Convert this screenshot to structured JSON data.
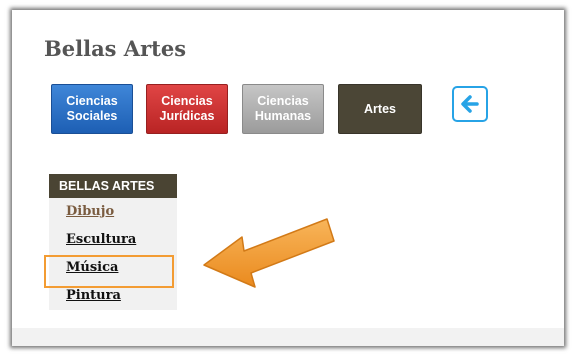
{
  "page": {
    "title": "Bellas Artes"
  },
  "categories": [
    {
      "label": "Ciencias\nSociales",
      "color": "#2a6fc4"
    },
    {
      "label": "Ciencias\nJurídicas",
      "color": "#c93030"
    },
    {
      "label": "Ciencias\nHumanas",
      "color": "#b0b0b0"
    },
    {
      "label": "Artes",
      "color": "#4b4636"
    }
  ],
  "back_button": {
    "icon": "arrow-left-icon",
    "color": "#27a3e6"
  },
  "sidebar": {
    "heading": "BELLAS ARTES",
    "items": [
      {
        "label": "Dibujo"
      },
      {
        "label": "Escultura"
      },
      {
        "label": "Música"
      },
      {
        "label": "Pintura"
      }
    ]
  },
  "annotation": {
    "highlight_color": "#f39c33",
    "arrow_color": "#f39c33"
  }
}
